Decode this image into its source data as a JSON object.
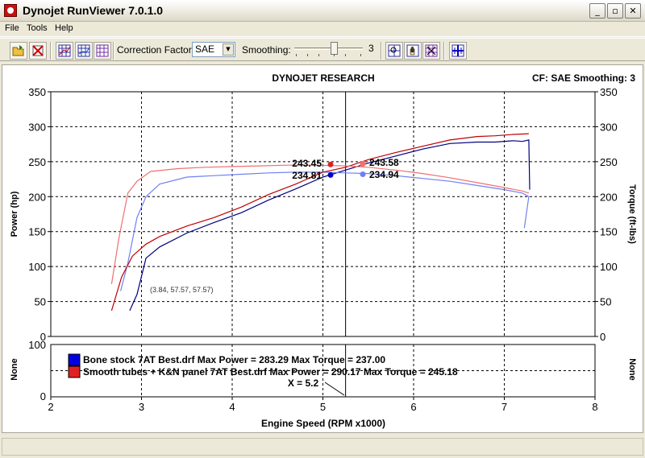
{
  "window": {
    "title": "Dynojet RunViewer 7.0.1.0"
  },
  "menu": [
    "File",
    "Tools",
    "Help"
  ],
  "toolbar": {
    "correction_factor_label": "Correction Factor:",
    "correction_factor_value": "SAE",
    "smoothing_label": "Smoothing:",
    "smoothing_value": "3",
    "smoothing_level": 3
  },
  "chart_data": {
    "type": "line",
    "title": "DYNOJET RESEARCH",
    "status": "CF: SAE  Smoothing: 3",
    "xlabel": "Engine Speed (RPM x1000)",
    "ylabel_left": "Power (hp)",
    "ylabel_right": "Torque (ft-lbs)",
    "xlim": [
      2,
      8
    ],
    "ylim": [
      0,
      350
    ],
    "x_ticks": [
      "2",
      "3",
      "4",
      "5",
      "6",
      "7",
      "8"
    ],
    "y_ticks": [
      "0",
      "50",
      "100",
      "150",
      "200",
      "250",
      "300",
      "350"
    ],
    "lower_panel": {
      "ylabel_left": "None",
      "ylabel_right": "None",
      "y_ticks": [
        "0",
        "100"
      ]
    },
    "cursor_x": 5.25,
    "cursor_readout": "X = 5.2",
    "hover_readout": "(3.84, 57.57, 57.57)",
    "legend": [
      {
        "text": "Bone stock 7AT Best.drf Max Power = 283.29 Max Torque = 237.00",
        "color": "#0000c0"
      },
      {
        "text": "Smooth tubes + K&N panel 7AT Best.drf Max Power = 290.17 Max Torque = 245.18",
        "color": "#e02020"
      }
    ],
    "cursor_values": [
      {
        "text": "243.45",
        "color": "#e02020",
        "y": 246
      },
      {
        "text": "234.81",
        "color": "#0000c0",
        "y": 231
      },
      {
        "text": "243.58",
        "color": "#f07070",
        "y": 247
      },
      {
        "text": "234.94",
        "color": "#7080f0",
        "y": 232
      }
    ],
    "series": [
      {
        "name": "Bone stock 7AT Best.drf - Power",
        "color": "#000080",
        "x": [
          2.87,
          2.95,
          3.05,
          3.2,
          3.5,
          3.8,
          4.1,
          4.4,
          4.7,
          5.0,
          5.25,
          5.5,
          5.8,
          6.1,
          6.4,
          6.7,
          6.9,
          7.1,
          7.2,
          7.27,
          7.28
        ],
        "y": [
          37,
          60,
          112,
          128,
          148,
          163,
          177,
          195,
          211,
          228,
          238,
          248,
          258,
          268,
          276,
          278,
          278,
          280,
          279,
          281,
          210
        ]
      },
      {
        "name": "Bone stock 7AT Best.drf - Torque",
        "color": "#7080f0",
        "x": [
          2.77,
          2.85,
          2.95,
          3.05,
          3.2,
          3.5,
          3.8,
          4.1,
          4.4,
          4.7,
          5.0,
          5.25,
          5.5,
          5.8,
          6.1,
          6.4,
          6.7,
          7.0,
          7.2,
          7.27,
          7.22
        ],
        "y": [
          65,
          105,
          170,
          200,
          218,
          228,
          230,
          232,
          234,
          235,
          235,
          234,
          233,
          230,
          226,
          222,
          216,
          210,
          205,
          200,
          155
        ]
      },
      {
        "name": "Smooth tubes + K&N panel 7AT Best.drf - Power",
        "color": "#c00000",
        "x": [
          2.67,
          2.78,
          2.9,
          3.05,
          3.2,
          3.5,
          3.8,
          4.1,
          4.4,
          4.7,
          5.0,
          5.25,
          5.5,
          5.8,
          6.1,
          6.4,
          6.7,
          6.9,
          7.1,
          7.27
        ],
        "y": [
          37,
          85,
          115,
          132,
          143,
          158,
          170,
          185,
          203,
          218,
          235,
          242,
          253,
          263,
          272,
          281,
          286,
          287,
          289,
          290
        ]
      },
      {
        "name": "Smooth tubes + K&N panel 7AT Best.drf - Torque",
        "color": "#f07070",
        "x": [
          2.67,
          2.75,
          2.85,
          2.95,
          3.1,
          3.4,
          3.7,
          4.0,
          4.3,
          4.6,
          4.9,
          5.25,
          5.5,
          5.8,
          6.1,
          6.4,
          6.7,
          7.0,
          7.2,
          7.27
        ],
        "y": [
          75,
          140,
          205,
          222,
          236,
          240,
          242,
          243,
          244,
          245,
          245,
          244,
          242,
          238,
          233,
          227,
          220,
          213,
          208,
          205
        ]
      }
    ]
  }
}
